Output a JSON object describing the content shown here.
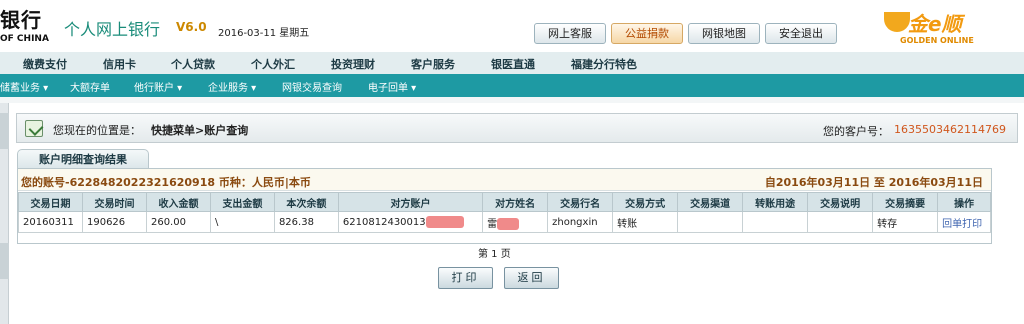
{
  "header": {
    "bank_name": "银行",
    "bank_en": "OF CHINA",
    "system_title": "个人网上银行",
    "version": "V6.0",
    "date": "2016-03-11 星期五",
    "buttons": {
      "customer_service": "网上客服",
      "charity": "公益捐款",
      "sitemap": "网银地图",
      "logout": "安全退出"
    },
    "logo": {
      "text": "金e顺",
      "sub": "GOLDEN ONLINE"
    }
  },
  "main_nav": [
    "缴费支付",
    "信用卡",
    "个人贷款",
    "个人外汇",
    "投资理财",
    "客户服务",
    "银医直通",
    "福建分行特色"
  ],
  "sub_nav": [
    "储蓄业务",
    "大额存单",
    "他行账户",
    "企业服务",
    "网银交易查询",
    "电子回单"
  ],
  "location": {
    "label": "您现在的位置是：",
    "path": "快捷菜单>账户查询",
    "customer_label": "您的客户号：",
    "customer_no": "1635503462114769"
  },
  "panel": {
    "tab_title": "账户明细查询结果",
    "account_prefix": "您的账号",
    "account_no": "6228482022321620918",
    "currency": "币种：人民币|本币",
    "date_range": "自2016年03月11日 至 2016年03月11日"
  },
  "table": {
    "headers": [
      "交易日期",
      "交易时间",
      "收入金额",
      "支出金额",
      "本次余额",
      "对方账户",
      "对方姓名",
      "交易行名",
      "交易方式",
      "交易渠道",
      "转账用途",
      "交易说明",
      "交易摘要",
      "操作"
    ],
    "rows": [
      {
        "date": "20160311",
        "time": "190626",
        "income": "260.00",
        "expense": "\\",
        "balance": "826.38",
        "counter_account": "6210812430013",
        "counter_name": "雷",
        "bank_name": "zhongxin",
        "method": "转账",
        "channel": "",
        "purpose": "",
        "description": "",
        "summary": "转存",
        "action": "回单打印"
      }
    ]
  },
  "pagination": {
    "page_label": "第 1 页"
  },
  "actions": {
    "print": "打印",
    "back": "返回"
  },
  "colors": {
    "teal": "#1e9aa3",
    "orange_text": "#d0561c",
    "brown_text": "#8a4a10"
  }
}
